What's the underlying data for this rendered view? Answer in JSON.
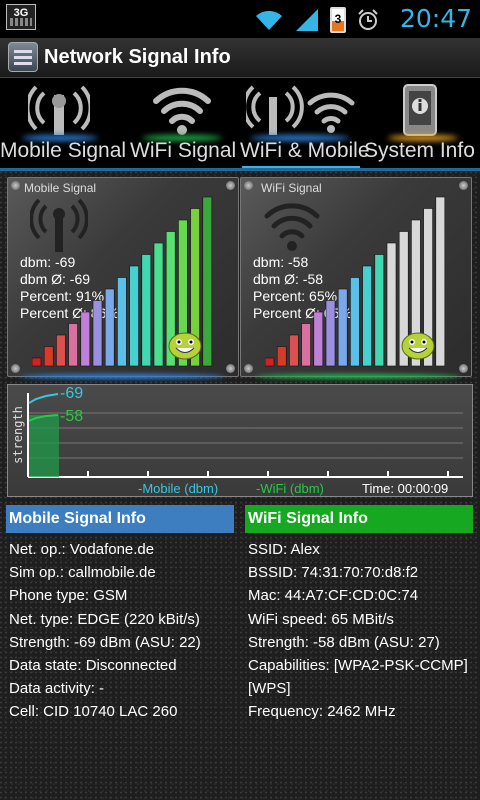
{
  "status_bar": {
    "network_type": "3G",
    "battery_level": "3",
    "time": "20:47",
    "time_color": "#35b5e5"
  },
  "app": {
    "title": "Network Signal Info"
  },
  "tabs": [
    {
      "label": "Mobile Signal",
      "icon": "cell-tower-icon",
      "glow": "#2e7fd6",
      "active": false
    },
    {
      "label": "WiFi Signal",
      "icon": "wifi-icon",
      "glow": "#22b14c",
      "active": false
    },
    {
      "label": "WiFi & Mobile",
      "icon": "wifi-mobile-icon",
      "glow": "#2e7fd6",
      "active": true
    },
    {
      "label": "System Info",
      "icon": "phone-info-icon",
      "glow": "#e8a31e",
      "active": false
    }
  ],
  "mobile_panel": {
    "title": "Mobile Signal",
    "dbm": "dbm: -69",
    "dbm_avg": "dbm Ø: -69",
    "percent": "Percent: 91%",
    "percent_avg": "Percent Ø: 86%",
    "signal_percent": 91,
    "accent": "#2e7fd6"
  },
  "wifi_panel": {
    "title": "WiFi Signal",
    "dbm": "dbm: -58",
    "dbm_avg": "dbm Ø: -58",
    "percent": "Percent: 65%",
    "percent_avg": "Percent Ø: 65%",
    "signal_percent": 65,
    "accent": "#22b14c"
  },
  "graph": {
    "y_label": "strength",
    "mobile_value_label": "-69",
    "wifi_value_label": "-58",
    "mobile_legend": "-Mobile (dbm)",
    "wifi_legend": "-WiFi (dbm)",
    "time_label": "Time: 00:00:09",
    "mobile_color": "#35c8e0",
    "wifi_color": "#22cc44"
  },
  "mobile_info": {
    "header": "Mobile Signal Info",
    "header_color": "#3c7ec0",
    "lines": [
      "Net. op.: Vodafone.de",
      "Sim op.: callmobile.de",
      "Phone type: GSM",
      "Net. type: EDGE (220 kBit/s)",
      "Strength: -69 dBm (ASU: 22)",
      "Data state: Disconnected",
      "Data activity: -",
      "Cell: CID 10740 LAC 260"
    ]
  },
  "wifi_info": {
    "header": "WiFi Signal Info",
    "header_color": "#16a820",
    "lines": [
      "SSID: Alex",
      "BSSID: 74:31:70:70:d8:f2",
      "Mac: 44:A7:CF:CD:0C:74",
      "WiFi speed: 65 MBit/s",
      "Strength: -58 dBm (ASU: 27)",
      "Capabilities: [WPA2-PSK-CCMP][WPS]",
      "Frequency: 2462 MHz"
    ]
  }
}
